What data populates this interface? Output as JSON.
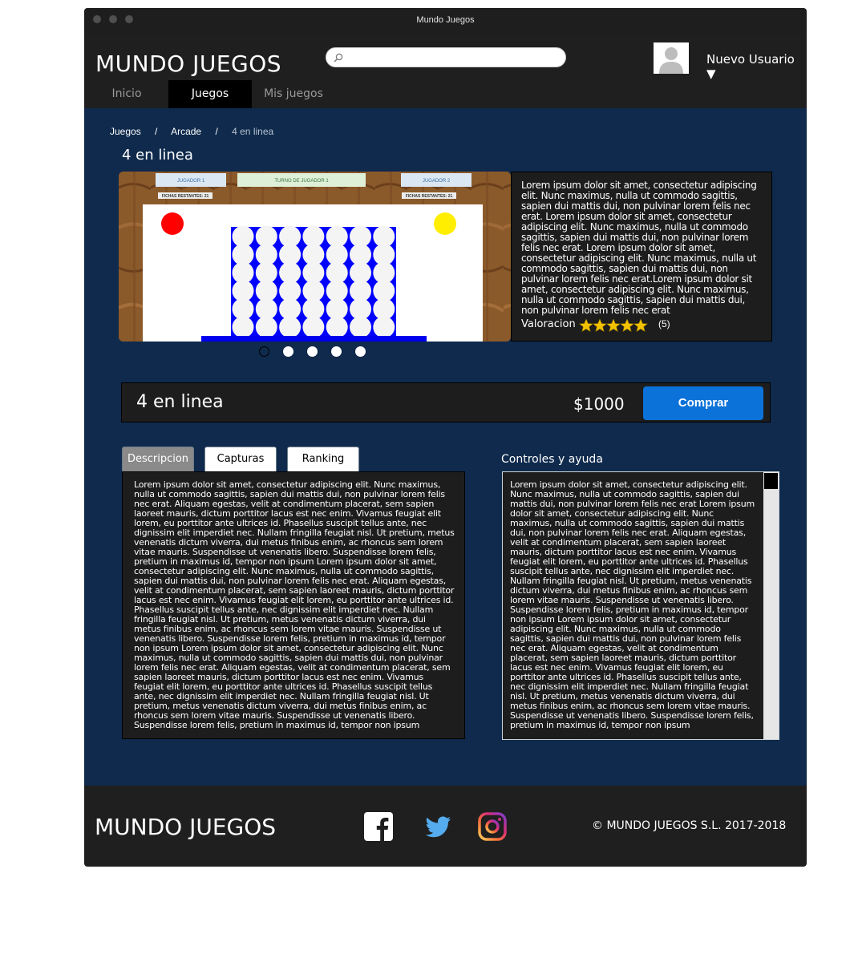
{
  "window": {
    "title": "Mundo Juegos"
  },
  "header": {
    "logo": "MUNDO JUEGOS",
    "search": {
      "value": "",
      "placeholder": ""
    },
    "user": {
      "name": "Nuevo Usuario ▼"
    },
    "nav": [
      {
        "label": "Inicio",
        "active": false
      },
      {
        "label": "Juegos",
        "active": true
      },
      {
        "label": "Mis juegos",
        "active": false
      }
    ]
  },
  "breadcrumb": {
    "items": [
      "Juegos",
      "Arcade",
      "4 en linea"
    ],
    "separator": "/"
  },
  "game": {
    "title": "4 en linea",
    "screenshot": {
      "player1": "JUGADOR 1",
      "turn": "TURNO DE JUGADOR 1",
      "player2": "JUGADOR 2",
      "pieces_left_1": "FICHAS RESTANTES: 21",
      "pieces_left_2": "FICHAS RESTANTES: 21"
    },
    "carousel": {
      "count": 5,
      "active_index": 0
    },
    "description": "Lorem ipsum dolor sit amet, consectetur adipiscing elit. Nunc maximus, nulla ut commodo sagittis, sapien dui mattis dui, non pulvinar lorem felis nec erat. Lorem ipsum dolor sit amet, consectetur adipiscing elit. Nunc maximus, nulla ut commodo sagittis, sapien dui mattis dui, non pulvinar lorem felis nec erat. Lorem ipsum dolor sit amet, consectetur adipiscing elit. Nunc maximus, nulla ut commodo sagittis, sapien dui mattis dui, non pulvinar lorem felis nec erat.Lorem ipsum dolor sit amet, consectetur adipiscing elit. Nunc maximus, nulla ut commodo sagittis, sapien dui mattis dui, non pulvinar lorem felis nec erat",
    "rating_label": "Valoracion",
    "rating_stars": 5,
    "rating_count": "(5)",
    "price": "$1000",
    "buy_label": "Comprar"
  },
  "tabs": [
    {
      "label": "Descripcion",
      "active": true
    },
    {
      "label": "Capturas",
      "active": false
    },
    {
      "label": "Ranking",
      "active": false
    }
  ],
  "tab_content": "Lorem ipsum dolor sit amet, consectetur adipiscing elit. Nunc maximus, nulla ut commodo sagittis, sapien dui mattis dui, non pulvinar lorem felis nec erat. Aliquam egestas, velit at condimentum placerat, sem sapien laoreet mauris, dictum porttitor lacus est nec enim. Vivamus feugiat elit lorem, eu porttitor ante ultrices id. Phasellus suscipit tellus ante, nec dignissim elit imperdiet nec. Nullam fringilla feugiat nisl. Ut pretium, metus venenatis dictum viverra, dui metus finibus enim, ac rhoncus sem lorem vitae mauris. Suspendisse ut venenatis libero. Suspendisse lorem felis, pretium in maximus id, tempor non ipsum Lorem ipsum dolor sit amet, consectetur adipiscing elit. Nunc maximus, nulla ut commodo sagittis, sapien dui mattis dui, non pulvinar lorem felis nec erat. Aliquam egestas, velit at condimentum placerat, sem sapien laoreet mauris, dictum porttitor lacus est nec enim. Vivamus feugiat elit lorem, eu porttitor ante ultrices id. Phasellus suscipit tellus ante, nec dignissim elit imperdiet nec. Nullam fringilla feugiat nisl. Ut pretium, metus venenatis dictum viverra, dui metus finibus enim, ac rhoncus sem lorem vitae mauris. Suspendisse ut venenatis libero. Suspendisse lorem felis, pretium in maximus id, tempor non ipsum Lorem ipsum dolor sit amet, consectetur adipiscing elit. Nunc maximus, nulla ut commodo sagittis, sapien dui mattis dui, non pulvinar lorem felis nec erat. Aliquam egestas, velit at condimentum placerat, sem sapien laoreet mauris, dictum porttitor lacus est nec enim. Vivamus feugiat elit lorem, eu porttitor ante ultrices id. Phasellus suscipit tellus ante, nec dignissim elit imperdiet nec. Nullam fringilla feugiat nisl. Ut pretium, metus venenatis dictum viverra, dui metus finibus enim, ac rhoncus sem lorem vitae mauris. Suspendisse ut venenatis libero. Suspendisse lorem felis, pretium in maximus id, tempor non ipsum",
  "help": {
    "title": "Controles y ayuda",
    "text": "Lorem ipsum dolor sit amet, consectetur adipiscing elit. Nunc maximus, nulla ut commodo sagittis, sapien dui mattis dui, non pulvinar lorem felis nec erat Lorem ipsum dolor sit amet, consectetur adipiscing elit. Nunc maximus, nulla ut commodo sagittis, sapien dui mattis dui, non pulvinar lorem felis nec erat. Aliquam egestas, velit at condimentum placerat, sem sapien laoreet mauris, dictum porttitor lacus est nec enim. Vivamus feugiat elit lorem, eu porttitor ante ultrices id. Phasellus suscipit tellus ante, nec dignissim elit imperdiet nec. Nullam fringilla feugiat nisl. Ut pretium, metus venenatis dictum viverra, dui metus finibus enim, ac rhoncus sem lorem vitae mauris. Suspendisse ut venenatis libero. Suspendisse lorem felis, pretium in maximus id, tempor non ipsum Lorem ipsum dolor sit amet, consectetur adipiscing elit. Nunc maximus, nulla ut commodo sagittis, sapien dui mattis dui, non pulvinar lorem felis nec erat. Aliquam egestas, velit at condimentum placerat, sem sapien laoreet mauris, dictum porttitor lacus est nec enim. Vivamus feugiat elit lorem, eu porttitor ante ultrices id. Phasellus suscipit tellus ante, nec dignissim elit imperdiet nec. Nullam fringilla feugiat nisl. Ut pretium, metus venenatis dictum viverra, dui metus finibus enim, ac rhoncus sem lorem vitae mauris. Suspendisse ut venenatis libero. Suspendisse lorem felis, pretium in maximus id, tempor non ipsum"
  },
  "footer": {
    "logo": "MUNDO JUEGOS",
    "social": [
      "facebook-icon",
      "twitter-icon",
      "instagram-icon"
    ],
    "copyright": "© MUNDO JUEGOS S.L. 2017-2018"
  },
  "colors": {
    "main_background": "#0f2a4c",
    "panel": "#1d1d1d",
    "header": "#1f1f1f",
    "buy_button": "#0a72d8",
    "twitter": "#55acee",
    "star": "#f2c200"
  }
}
